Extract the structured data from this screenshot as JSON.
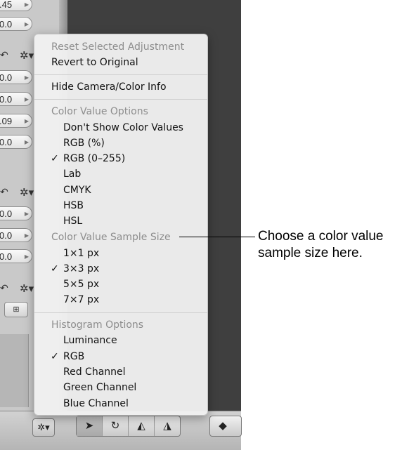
{
  "left_panel": {
    "fields": [
      ".45",
      "0.0",
      "0.0",
      "0.0",
      ".09",
      "0.0",
      "0.0",
      "0.0",
      "0.0"
    ],
    "tool_icons": [
      "undo-icon",
      "gear-icon"
    ]
  },
  "menu": {
    "reset": "Reset Selected Adjustment",
    "revert": "Revert to Original",
    "hide_camera": "Hide Camera/Color Info",
    "color_value_header": "Color Value Options",
    "color_value_items": [
      "Don't Show Color Values",
      "RGB (%)",
      "RGB (0–255)",
      "Lab",
      "CMYK",
      "HSB",
      "HSL"
    ],
    "sample_size_header": "Color Value Sample Size",
    "sample_size_items": [
      "1×1 px",
      "3×3 px",
      "5×5 px",
      "7×7 px"
    ],
    "histogram_header": "Histogram Options",
    "histogram_items": [
      "Luminance",
      "RGB",
      "Red Channel",
      "Green Channel",
      "Blue Channel"
    ],
    "check_mark": "✓",
    "checked": [
      "RGB (0–255)",
      "3×3 px",
      "RGB"
    ]
  },
  "callout": {
    "line1": "Choose a color value",
    "line2": "sample size here."
  },
  "toolbar": {
    "icons": [
      "select-arrow-icon",
      "rotate-icon",
      "straighten-icon",
      "crop-icon",
      "lift-icon"
    ]
  }
}
